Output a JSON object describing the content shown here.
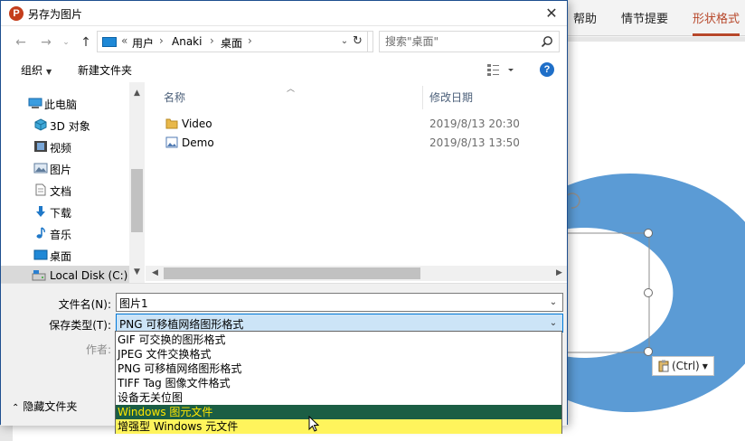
{
  "ppt": {
    "tabs": [
      {
        "label": "帮助"
      },
      {
        "label": "情节提要"
      },
      {
        "label": "形状格式"
      }
    ],
    "paste_options_label": "(Ctrl)"
  },
  "dialog": {
    "app_badge": "P",
    "title": "另存为图片",
    "close_symbol": "✕",
    "address": {
      "overflow": "«",
      "crumbs": [
        {
          "label": "用户"
        },
        {
          "label": "Anaki"
        },
        {
          "label": "桌面"
        }
      ]
    },
    "search_placeholder": "搜索\"桌面\"",
    "toolbar": {
      "organize": "组织",
      "new_folder": "新建文件夹"
    },
    "nav_items": [
      {
        "label": "此电脑",
        "icon": "pc-icon"
      },
      {
        "label": "3D 对象",
        "icon": "cube-3d-icon"
      },
      {
        "label": "视频",
        "icon": "video-icon"
      },
      {
        "label": "图片",
        "icon": "pictures-icon"
      },
      {
        "label": "文档",
        "icon": "document-icon"
      },
      {
        "label": "下载",
        "icon": "download-icon"
      },
      {
        "label": "音乐",
        "icon": "music-icon"
      },
      {
        "label": "桌面",
        "icon": "desktop-icon"
      },
      {
        "label": "Local Disk (C:)",
        "icon": "disk-icon"
      }
    ],
    "columns": {
      "name": "名称",
      "modified": "修改日期"
    },
    "files": [
      {
        "name": "Video",
        "date": "2019/8/13 20:30",
        "icon": "folder-icon"
      },
      {
        "name": "Demo",
        "date": "2019/8/13 13:50",
        "icon": "image-file-icon"
      }
    ],
    "form": {
      "filename_label": "文件名(N):",
      "filename_value": "图片1",
      "type_label": "保存类型(T):",
      "type_value": "PNG 可移植网络图形格式",
      "author_label": "作者:",
      "hide_folders": "隐藏文件夹"
    },
    "type_options": [
      {
        "label": "GIF 可交换的图形格式"
      },
      {
        "label": "JPEG 文件交换格式"
      },
      {
        "label": "PNG 可移植网络图形格式"
      },
      {
        "label": "TIFF Tag 图像文件格式"
      },
      {
        "label": "设备无关位图"
      },
      {
        "label": "Windows 图元文件"
      },
      {
        "label": "增强型 Windows 元文件"
      }
    ]
  },
  "colors": {
    "ppt_accent": "#b7472a",
    "ring_fill": "#5b9bd5",
    "hover_bg": "#1b5e44",
    "hover_text": "#ffe600",
    "current_bg": "#fff45c"
  }
}
